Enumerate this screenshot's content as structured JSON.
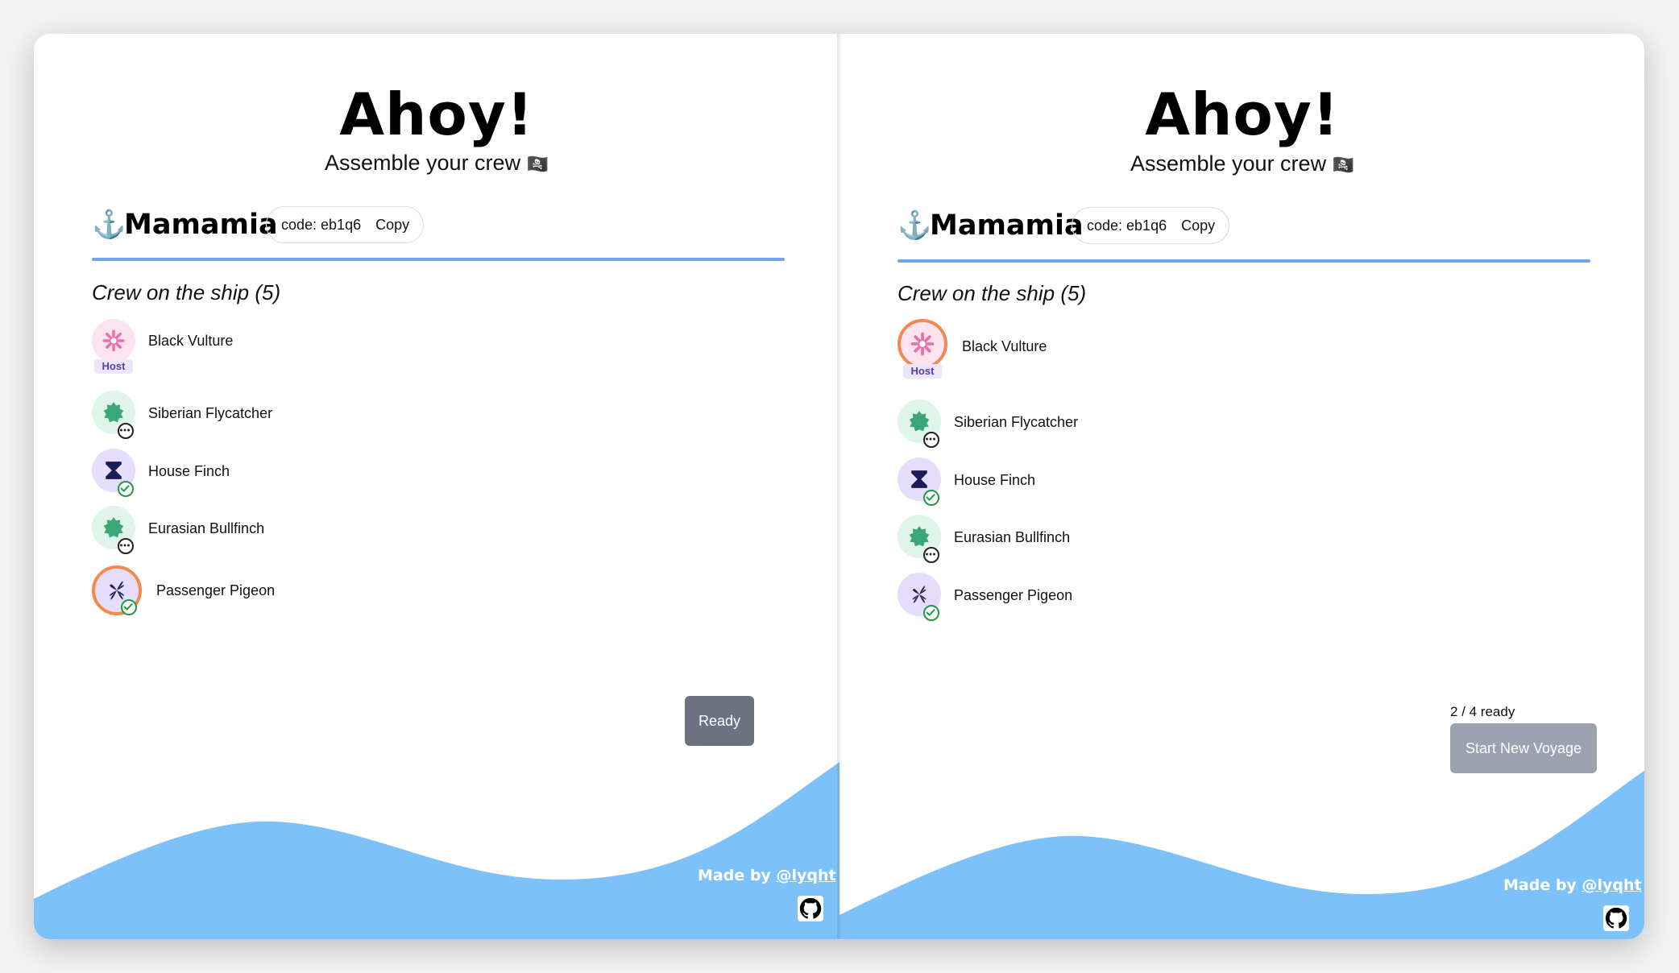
{
  "app": {
    "title": "Ahoy!",
    "subtitle": "Assemble your crew",
    "subtitle_flag": "🏴‍☠️",
    "ship_name": "Mamamia",
    "code_label": "code: eb1q6",
    "copy_label": "Copy",
    "crew_heading": "Crew on the ship (5)",
    "host_badge": "Host",
    "footer_made_by": "Made by",
    "footer_handle": "@lyqht"
  },
  "crew": [
    {
      "name": "Black Vulture",
      "icon": "flower-icon",
      "color": "#ec6fa8",
      "status": "host"
    },
    {
      "name": "Siberian Flycatcher",
      "icon": "badge-icon",
      "color": "#3aa876",
      "status": "waiting"
    },
    {
      "name": "House Finch",
      "icon": "hourglass-icon",
      "color": "#1b1d56",
      "status": "ready"
    },
    {
      "name": "Eurasian Bullfinch",
      "icon": "badge-icon",
      "color": "#3aa876",
      "status": "waiting"
    },
    {
      "name": "Passenger Pigeon",
      "icon": "petals-icon",
      "color": "#1b1d56",
      "status": "ready"
    }
  ],
  "left_panel": {
    "current_user": "Passenger Pigeon",
    "ready_button": "Ready"
  },
  "right_panel": {
    "current_user": "Black Vulture",
    "ready_count": "2 / 4 ready",
    "start_button": "Start New Voyage"
  },
  "colors": {
    "accent_rule": "#6ea5ee",
    "wave": "#7dc1fb",
    "current_user_ring": "#f4894f",
    "ready_green": "#1f9a42",
    "host_badge_text": "#5b3ab0"
  }
}
